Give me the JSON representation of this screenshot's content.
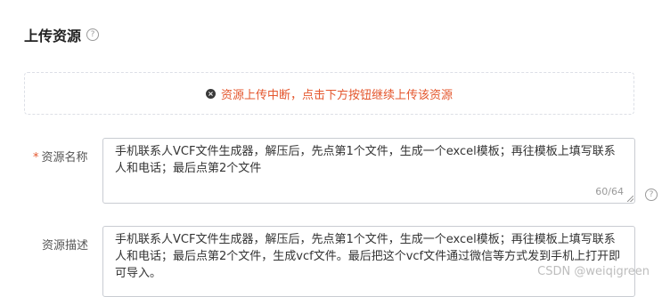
{
  "section": {
    "title": "上传资源",
    "help_icon": "question-circle-icon"
  },
  "upload": {
    "error_icon": "close-circle-icon",
    "error_message": "资源上传中断，点击下方按钮继续上传该资源",
    "error_color": "#e4572e"
  },
  "fields": {
    "name": {
      "required_mark": "*",
      "label": "资源名称",
      "value": "手机联系人VCF文件生成器，解压后，先点第1个文件，生成一个excel模板；再往模板上填写联系人和电话；最后点第2个文件",
      "char_count": "60/64",
      "help_icon": "question-circle-icon"
    },
    "description": {
      "label": "资源描述",
      "value": "手机联系人VCF文件生成器，解压后，先点第1个文件，生成一个excel模板；再往模板上填写联系人和电话；最后点第2个文件，生成vcf文件。最后把这个vcf文件通过微信等方式发到手机上打开即可导入。"
    }
  },
  "watermark": "CSDN @weiqigreen"
}
